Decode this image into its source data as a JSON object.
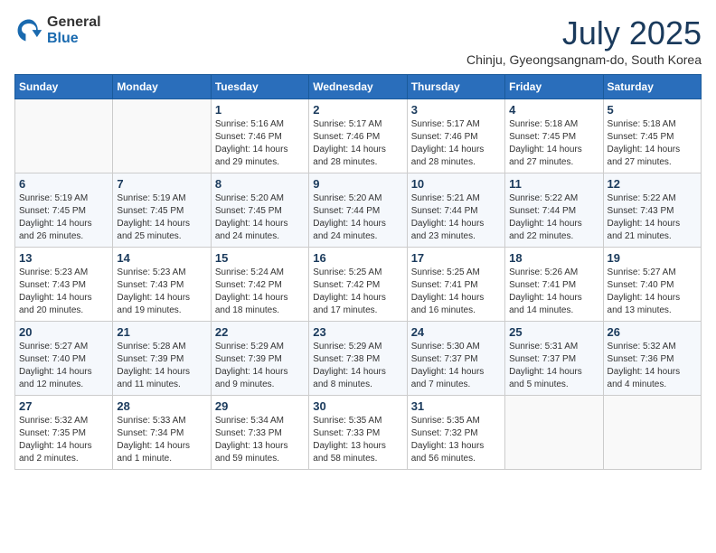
{
  "header": {
    "logo": {
      "general": "General",
      "blue": "Blue"
    },
    "title": "July 2025",
    "location": "Chinju, Gyeongsangnam-do, South Korea"
  },
  "calendar": {
    "columns": [
      "Sunday",
      "Monday",
      "Tuesday",
      "Wednesday",
      "Thursday",
      "Friday",
      "Saturday"
    ],
    "weeks": [
      [
        {
          "day": "",
          "content": ""
        },
        {
          "day": "",
          "content": ""
        },
        {
          "day": "1",
          "content": "Sunrise: 5:16 AM\nSunset: 7:46 PM\nDaylight: 14 hours\nand 29 minutes."
        },
        {
          "day": "2",
          "content": "Sunrise: 5:17 AM\nSunset: 7:46 PM\nDaylight: 14 hours\nand 28 minutes."
        },
        {
          "day": "3",
          "content": "Sunrise: 5:17 AM\nSunset: 7:46 PM\nDaylight: 14 hours\nand 28 minutes."
        },
        {
          "day": "4",
          "content": "Sunrise: 5:18 AM\nSunset: 7:45 PM\nDaylight: 14 hours\nand 27 minutes."
        },
        {
          "day": "5",
          "content": "Sunrise: 5:18 AM\nSunset: 7:45 PM\nDaylight: 14 hours\nand 27 minutes."
        }
      ],
      [
        {
          "day": "6",
          "content": "Sunrise: 5:19 AM\nSunset: 7:45 PM\nDaylight: 14 hours\nand 26 minutes."
        },
        {
          "day": "7",
          "content": "Sunrise: 5:19 AM\nSunset: 7:45 PM\nDaylight: 14 hours\nand 25 minutes."
        },
        {
          "day": "8",
          "content": "Sunrise: 5:20 AM\nSunset: 7:45 PM\nDaylight: 14 hours\nand 24 minutes."
        },
        {
          "day": "9",
          "content": "Sunrise: 5:20 AM\nSunset: 7:44 PM\nDaylight: 14 hours\nand 24 minutes."
        },
        {
          "day": "10",
          "content": "Sunrise: 5:21 AM\nSunset: 7:44 PM\nDaylight: 14 hours\nand 23 minutes."
        },
        {
          "day": "11",
          "content": "Sunrise: 5:22 AM\nSunset: 7:44 PM\nDaylight: 14 hours\nand 22 minutes."
        },
        {
          "day": "12",
          "content": "Sunrise: 5:22 AM\nSunset: 7:43 PM\nDaylight: 14 hours\nand 21 minutes."
        }
      ],
      [
        {
          "day": "13",
          "content": "Sunrise: 5:23 AM\nSunset: 7:43 PM\nDaylight: 14 hours\nand 20 minutes."
        },
        {
          "day": "14",
          "content": "Sunrise: 5:23 AM\nSunset: 7:43 PM\nDaylight: 14 hours\nand 19 minutes."
        },
        {
          "day": "15",
          "content": "Sunrise: 5:24 AM\nSunset: 7:42 PM\nDaylight: 14 hours\nand 18 minutes."
        },
        {
          "day": "16",
          "content": "Sunrise: 5:25 AM\nSunset: 7:42 PM\nDaylight: 14 hours\nand 17 minutes."
        },
        {
          "day": "17",
          "content": "Sunrise: 5:25 AM\nSunset: 7:41 PM\nDaylight: 14 hours\nand 16 minutes."
        },
        {
          "day": "18",
          "content": "Sunrise: 5:26 AM\nSunset: 7:41 PM\nDaylight: 14 hours\nand 14 minutes."
        },
        {
          "day": "19",
          "content": "Sunrise: 5:27 AM\nSunset: 7:40 PM\nDaylight: 14 hours\nand 13 minutes."
        }
      ],
      [
        {
          "day": "20",
          "content": "Sunrise: 5:27 AM\nSunset: 7:40 PM\nDaylight: 14 hours\nand 12 minutes."
        },
        {
          "day": "21",
          "content": "Sunrise: 5:28 AM\nSunset: 7:39 PM\nDaylight: 14 hours\nand 11 minutes."
        },
        {
          "day": "22",
          "content": "Sunrise: 5:29 AM\nSunset: 7:39 PM\nDaylight: 14 hours\nand 9 minutes."
        },
        {
          "day": "23",
          "content": "Sunrise: 5:29 AM\nSunset: 7:38 PM\nDaylight: 14 hours\nand 8 minutes."
        },
        {
          "day": "24",
          "content": "Sunrise: 5:30 AM\nSunset: 7:37 PM\nDaylight: 14 hours\nand 7 minutes."
        },
        {
          "day": "25",
          "content": "Sunrise: 5:31 AM\nSunset: 7:37 PM\nDaylight: 14 hours\nand 5 minutes."
        },
        {
          "day": "26",
          "content": "Sunrise: 5:32 AM\nSunset: 7:36 PM\nDaylight: 14 hours\nand 4 minutes."
        }
      ],
      [
        {
          "day": "27",
          "content": "Sunrise: 5:32 AM\nSunset: 7:35 PM\nDaylight: 14 hours\nand 2 minutes."
        },
        {
          "day": "28",
          "content": "Sunrise: 5:33 AM\nSunset: 7:34 PM\nDaylight: 14 hours\nand 1 minute."
        },
        {
          "day": "29",
          "content": "Sunrise: 5:34 AM\nSunset: 7:33 PM\nDaylight: 13 hours\nand 59 minutes."
        },
        {
          "day": "30",
          "content": "Sunrise: 5:35 AM\nSunset: 7:33 PM\nDaylight: 13 hours\nand 58 minutes."
        },
        {
          "day": "31",
          "content": "Sunrise: 5:35 AM\nSunset: 7:32 PM\nDaylight: 13 hours\nand 56 minutes."
        },
        {
          "day": "",
          "content": ""
        },
        {
          "day": "",
          "content": ""
        }
      ]
    ]
  }
}
